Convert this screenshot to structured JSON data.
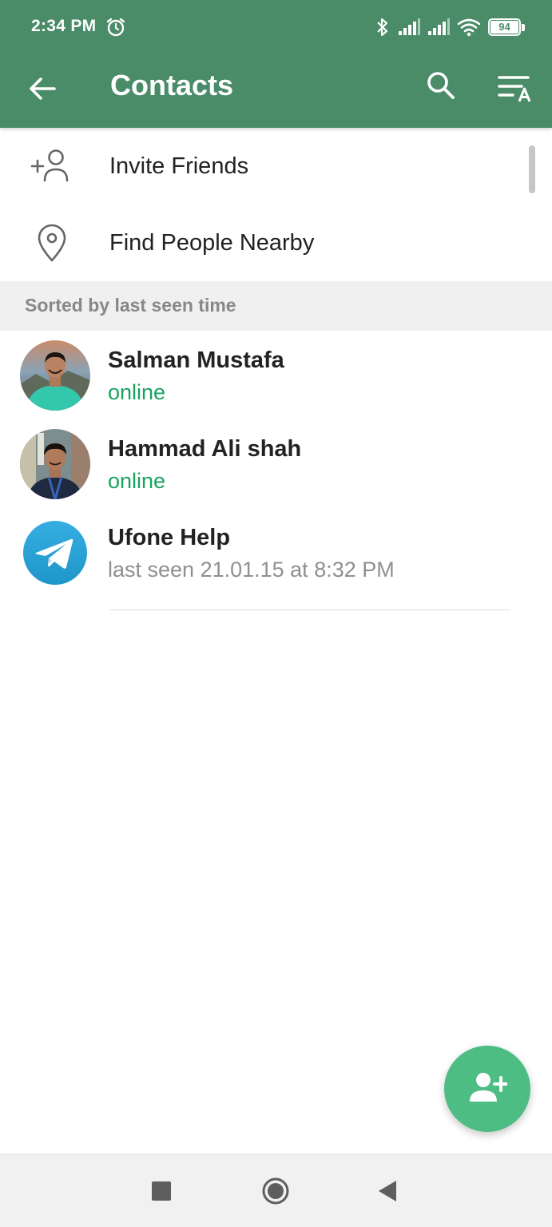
{
  "status_bar": {
    "time": "2:34 PM",
    "battery": "94"
  },
  "header": {
    "title": "Contacts"
  },
  "actions": [
    {
      "label": "Invite Friends",
      "icon": "add-person-icon"
    },
    {
      "label": "Find People Nearby",
      "icon": "location-pin-icon"
    }
  ],
  "section": {
    "label": "Sorted by last seen time"
  },
  "contacts": [
    {
      "name": "Salman Mustafa",
      "status": "online"
    },
    {
      "name": "Hammad Ali shah",
      "status": "online"
    },
    {
      "name": "Ufone Help",
      "status": "last seen 21.01.15 at 8:32 PM"
    }
  ],
  "colors": {
    "header": "#4a8b68",
    "online": "#19a35f",
    "fab": "#4ebd84"
  }
}
